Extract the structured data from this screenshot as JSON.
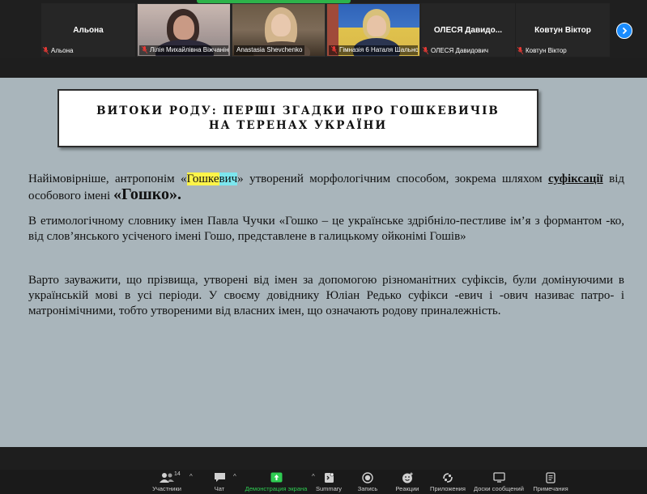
{
  "participants": [
    {
      "display_name": "Альона",
      "label": "Альона",
      "video": false
    },
    {
      "display_name": "",
      "label": "Лілія Михайлівна Віжчаніна",
      "video": true
    },
    {
      "display_name": "",
      "label": "Anastasia Shevchenko",
      "video": true
    },
    {
      "display_name": "",
      "label": "Гімназія 6 Наталя Шально...",
      "video": true
    },
    {
      "display_name": "ОЛЕСЯ  Давидо...",
      "label": "ОЛЕСЯ Давидович",
      "video": false
    },
    {
      "display_name": "Ковтун Віктор",
      "label": "Ковтун Віктор",
      "video": false
    }
  ],
  "slide": {
    "title": "ВИТОКИ РОДУ: ПЕРШІ ЗГАДКИ ПРО ГОШКЕВИЧІВ НА ТЕРЕНАХ УКРАЇНИ",
    "p1": {
      "a": "Найімовірніше, антропонім «",
      "hl1": "Гошке",
      "hl2": "вич",
      "b": "» утворений морфологічним способом, зокрема шляхом ",
      "underlined": "суфіксації",
      "c": " від особового імені ",
      "big": "«Гошко»."
    },
    "p2": "В етимологічному словнику імен Павла Чучки «Гошко – це українське здрібніло-пестливе ім’я з формантом -ко, від слов’янського усіченого імені Гошо, представлене в галицькому ойконімі Гошів»",
    "p3": "Варто зауважити, що прізвища, утворені від імен за допомогою різноманітних суфіксів, були домінуючими в українській мові в усі періоди. У своєму довіднику Юліан Редько суфікси -евич і -ович називає патро- і матронімічними, тобто утвореними від власних імен, що означають родову  приналежність."
  },
  "toolbar": {
    "participants_label": "Участники",
    "participants_count": "14",
    "chat_label": "Чат",
    "share_label": "Демонстрация экрана",
    "summary_label": "Summary",
    "record_label": "Запись",
    "reactions_label": "Реакции",
    "apps_label": "Приложения",
    "whiteboard_label": "Доски сообщений",
    "notes_label": "Примечания"
  },
  "colors": {
    "accent_green": "#2ecc52",
    "accent_blue": "#1a8cff",
    "slide_bg": "#a9b5bb",
    "highlight_yellow": "#fef44a",
    "highlight_cyan": "#7de6ee"
  }
}
